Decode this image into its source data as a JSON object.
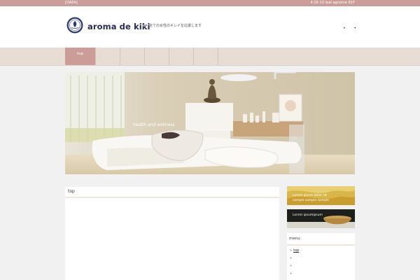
{
  "topbar": {
    "left": "[OAEA]",
    "right": "4-26-10 leaf agnome B1F"
  },
  "header": {
    "title": "aroma de kiki",
    "tagline": "全ての女性のキレイを応援します",
    "dots": "• •"
  },
  "nav": {
    "items": [
      {
        "label": "top",
        "active": true
      },
      {
        "label": ""
      },
      {
        "label": ""
      },
      {
        "label": ""
      },
      {
        "label": ""
      },
      {
        "label": ""
      }
    ]
  },
  "hero": {
    "caption": "health and wellness"
  },
  "content": {
    "title": "top"
  },
  "sidebar": {
    "banner1": {
      "line1": "Lorem ipsum dolor sit",
      "line2": "sample sample sample"
    },
    "banner2": {
      "text": "Lorem ipsumipsum"
    },
    "menu": {
      "title": "menu",
      "items": [
        {
          "bullet": "»",
          "label": "top"
        },
        {
          "bullet": "»",
          "label": ""
        },
        {
          "bullet": "»",
          "label": ""
        },
        {
          "bullet": "»",
          "label": ""
        }
      ]
    }
  },
  "colors": {
    "accent": "#cc9c98",
    "nav_bg": "#e8ddd5",
    "page_bg": "#f1f1f1"
  }
}
